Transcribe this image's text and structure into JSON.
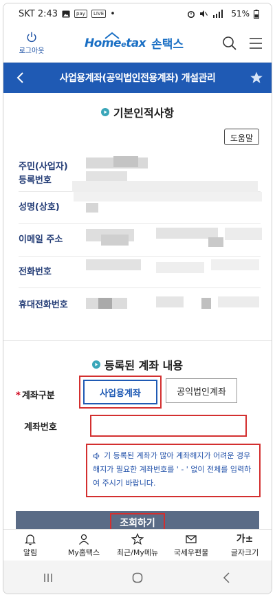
{
  "status_bar": {
    "carrier_time": "SKT 2:43",
    "badge1": "pay",
    "badge2": "LIVE",
    "dot": "•",
    "battery": "51%"
  },
  "header": {
    "logout_label": "로그아웃",
    "logo_en": "Home",
    "logo_e": "e",
    "logo_tax": "tax",
    "logo_kr": "손택스"
  },
  "titlebar": {
    "title": "사업용계좌(공익법인전용계좌) 개설관리"
  },
  "basic_info": {
    "heading": "기본인적사항",
    "help_label": "도움말",
    "rows": [
      {
        "label": "주민(사업자) 등록번호"
      },
      {
        "label": "성명(상호)"
      },
      {
        "label": "이메일 주소"
      },
      {
        "label": "전화번호"
      },
      {
        "label": "휴대전화번호"
      }
    ]
  },
  "registered": {
    "heading": "등록된 계좌 내용",
    "account_type_label": "계좌구분",
    "required_mark": "*",
    "type_options": [
      "사업용계좌",
      "공익법인계좌"
    ],
    "selected_type": "사업용계좌",
    "account_no_label": "계좌번호",
    "account_no_value": "",
    "notice": "기 등록된 계좌가 많아 계좌해지가 어려운 경우 해지가 필요한 계좌번호를 ' - ' 없이 전체를 입력하여 주시기 바랍니다.",
    "search_label": "조회하기"
  },
  "bottom_nav": [
    {
      "label": "알림",
      "icon": "bell-icon"
    },
    {
      "label": "My홈택스",
      "icon": "person-icon"
    },
    {
      "label": "최근/My메뉴",
      "icon": "star-outline-icon"
    },
    {
      "label": "국세우편물",
      "icon": "mail-icon"
    },
    {
      "label": "글자크기",
      "icon": "text-size-icon",
      "glyph": "가±"
    }
  ],
  "colors": {
    "primary": "#1f5ab4",
    "highlight": "#d32f2f",
    "button": "#5a6b86"
  }
}
